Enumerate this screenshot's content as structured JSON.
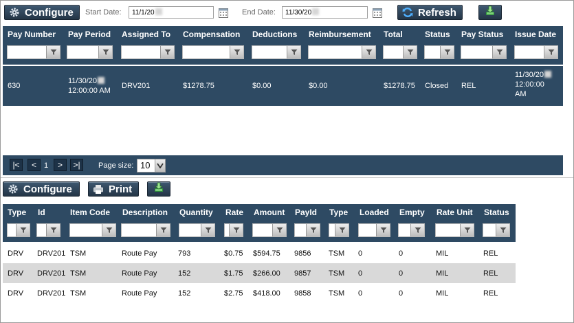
{
  "toolbar1": {
    "configure_label": "Configure",
    "start_date_label": "Start Date:",
    "start_date_value": "11/1/20",
    "end_date_label": "End Date:",
    "end_date_value": "11/30/20",
    "refresh_label": "Refresh"
  },
  "grid1": {
    "columns": [
      "Pay Number",
      "Pay Period",
      "Assigned To",
      "Compensation",
      "Deductions",
      "Reimbursement",
      "Total",
      "Status",
      "Pay Status",
      "Issue Date"
    ],
    "row": {
      "pay_number": "630",
      "pay_period_date": "11/30/20",
      "pay_period_time": "12:00:00 AM",
      "assigned_to": "DRV201",
      "compensation": "$1278.75",
      "deductions": "$0.00",
      "reimbursement": "$0.00",
      "total": "$1278.75",
      "status": "Closed",
      "pay_status": "REL",
      "issue_date_date": "11/30/20",
      "issue_date_time": "12:00:00",
      "issue_date_ampm": "AM"
    }
  },
  "pager": {
    "first": "|<",
    "prev": "<",
    "page": "1",
    "next": ">",
    "last": ">|",
    "page_size_label": "Page size:",
    "page_size_value": "10"
  },
  "toolbar2": {
    "configure_label": "Configure",
    "print_label": "Print"
  },
  "grid2": {
    "columns": [
      "Type",
      "Id",
      "Item Code",
      "Description",
      "Quantity",
      "Rate",
      "Amount",
      "PayId",
      "Type",
      "Loaded",
      "Empty",
      "Rate Unit",
      "Status"
    ],
    "rows": [
      [
        "DRV",
        "DRV201",
        "TSM",
        "Route Pay",
        "793",
        "$0.75",
        "$594.75",
        "9856",
        "TSM",
        "0",
        "0",
        "MIL",
        "REL"
      ],
      [
        "DRV",
        "DRV201",
        "TSM",
        "Route Pay",
        "152",
        "$1.75",
        "$266.00",
        "9857",
        "TSM",
        "0",
        "0",
        "MIL",
        "REL"
      ],
      [
        "DRV",
        "DRV201",
        "TSM",
        "Route Pay",
        "152",
        "$2.75",
        "$418.00",
        "9858",
        "TSM",
        "0",
        "0",
        "MIL",
        "REL"
      ]
    ]
  },
  "colors": {
    "header_bg": "#2e4a63",
    "button_bg": "#2b3f52",
    "alt_row_bg": "#d9d9d9"
  }
}
